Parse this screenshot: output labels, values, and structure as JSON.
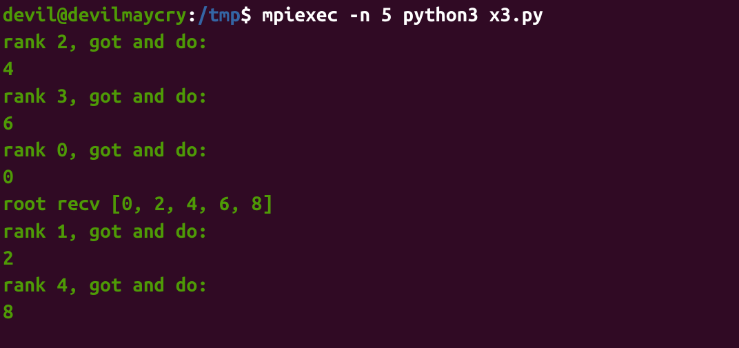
{
  "prompt": {
    "user_host": "devil@devilmaycry",
    "colon": ":",
    "path": "/tmp",
    "dollar": "$ ",
    "command": "mpiexec -n 5 python3 x3.py"
  },
  "output_lines": [
    "rank 2, got and do:",
    "4",
    "rank 3, got and do:",
    "6",
    "rank 0, got and do:",
    "0",
    "root recv [0, 2, 4, 6, 8]",
    "rank 1, got and do:",
    "2",
    "rank 4, got and do:",
    "8"
  ]
}
